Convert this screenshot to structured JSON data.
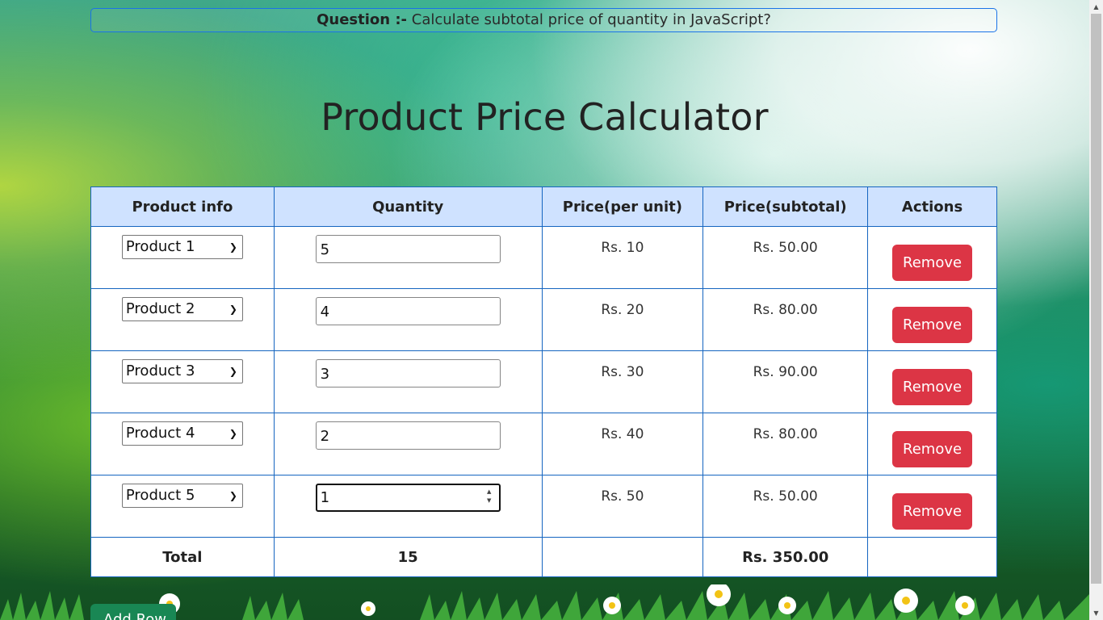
{
  "question": {
    "label": "Question :-",
    "text": "Calculate subtotal price of quantity in JavaScript?"
  },
  "title": "Product Price Calculator",
  "table": {
    "headers": {
      "product": "Product info",
      "quantity": "Quantity",
      "price": "Price(per unit)",
      "subtotal": "Price(subtotal)",
      "actions": "Actions"
    },
    "rows": [
      {
        "product": "Product 1",
        "quantity": "5",
        "price": "Rs. 10",
        "subtotal": "Rs. 50.00",
        "action": "Remove"
      },
      {
        "product": "Product 2",
        "quantity": "4",
        "price": "Rs. 20",
        "subtotal": "Rs. 80.00",
        "action": "Remove"
      },
      {
        "product": "Product 3",
        "quantity": "3",
        "price": "Rs. 30",
        "subtotal": "Rs. 90.00",
        "action": "Remove"
      },
      {
        "product": "Product 4",
        "quantity": "2",
        "price": "Rs. 40",
        "subtotal": "Rs. 80.00",
        "action": "Remove"
      },
      {
        "product": "Product 5",
        "quantity": "1",
        "price": "Rs. 50",
        "subtotal": "Rs. 50.00",
        "action": "Remove"
      }
    ],
    "total": {
      "label": "Total",
      "quantity": "15",
      "subtotal": "Rs. 350.00"
    }
  },
  "add_row_button": "Add Row",
  "colors": {
    "header_bg": "#cfe2ff",
    "border": "#1565c0",
    "remove_button": "#dc3545",
    "add_button": "#198754"
  },
  "icons": {
    "select_arrow": "chevron-down-icon",
    "spinner": "spinner-arrows-icon"
  }
}
